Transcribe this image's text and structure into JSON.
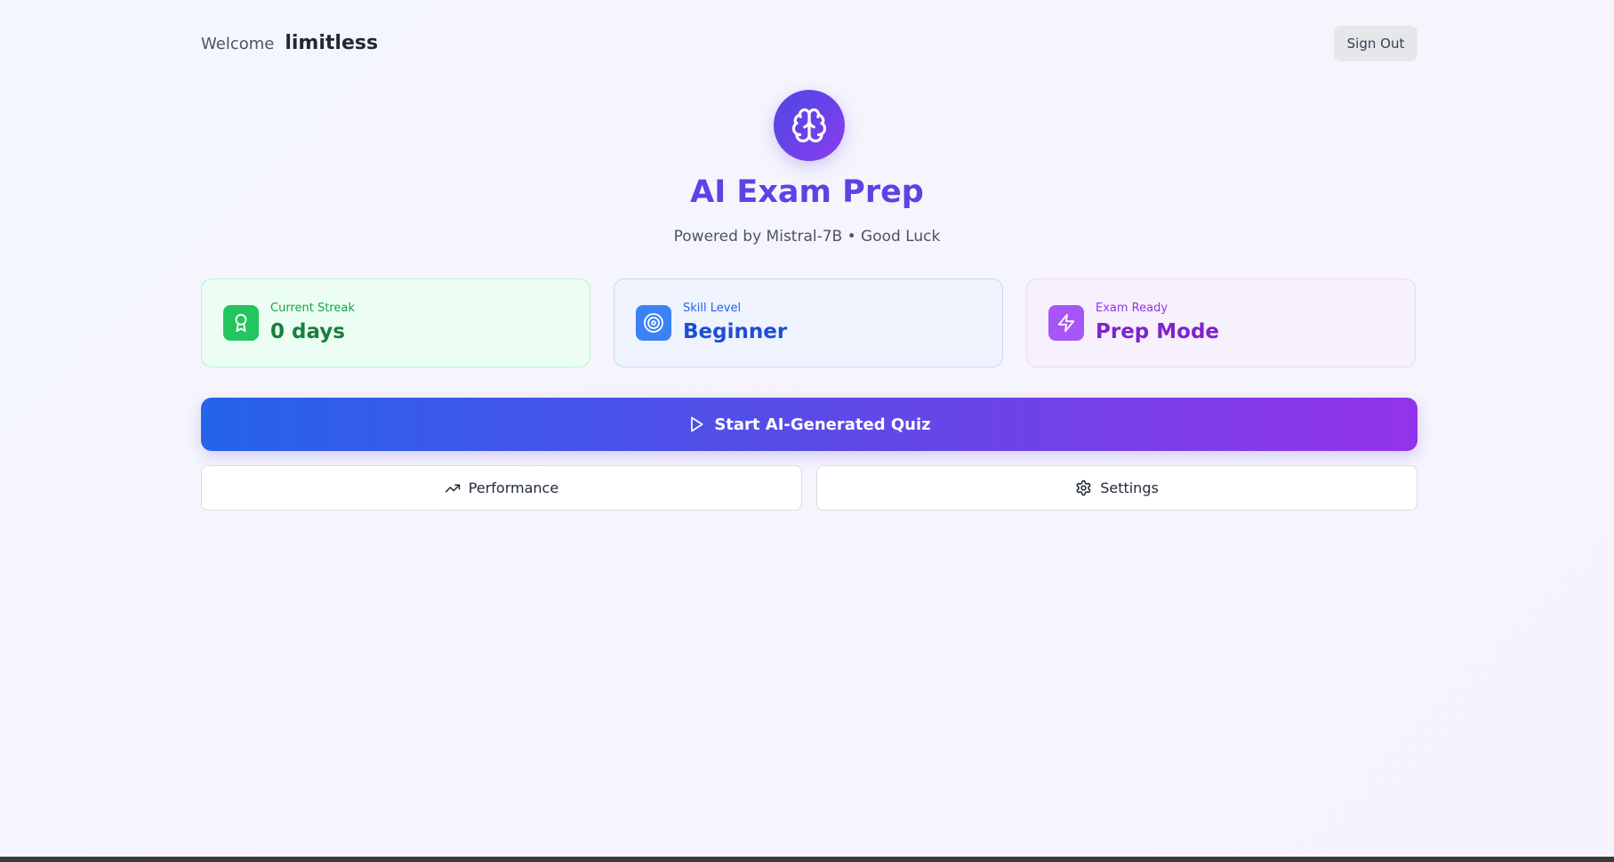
{
  "header": {
    "welcome_label": "Welcome",
    "username": "limitless",
    "sign_out_label": "Sign Out"
  },
  "hero": {
    "logo_icon": "brain-icon",
    "title": "AI Exam Prep",
    "subtitle": "Powered by Mistral-7B • Good Luck"
  },
  "stats": [
    {
      "label": "Current Streak",
      "value": "0 days",
      "icon": "award-icon",
      "color": "#22c55e"
    },
    {
      "label": "Skill Level",
      "value": "Beginner",
      "icon": "target-icon",
      "color": "#3b82f6"
    },
    {
      "label": "Exam Ready",
      "value": "Prep Mode",
      "icon": "zap-icon",
      "color": "#a855f7"
    }
  ],
  "actions": {
    "start_quiz_label": "Start AI-Generated Quiz",
    "start_quiz_icon": "play-icon",
    "performance_label": "Performance",
    "performance_icon": "trending-up-icon",
    "settings_label": "Settings",
    "settings_icon": "gear-icon"
  },
  "colors": {
    "accent_start": "#2563eb",
    "accent_end": "#9333ea",
    "title": "#5b44e3"
  }
}
